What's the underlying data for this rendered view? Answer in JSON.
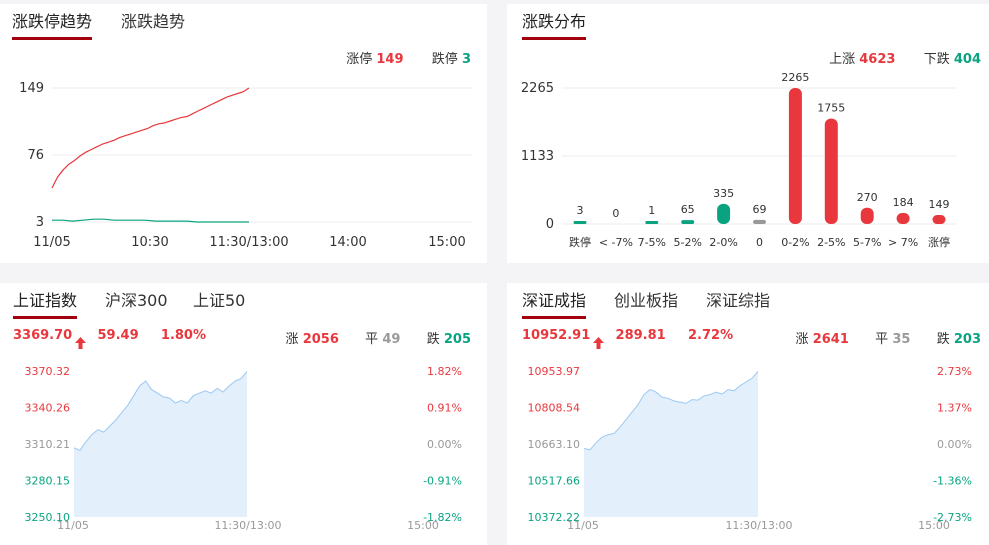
{
  "trend": {
    "tabs": [
      "涨跌停趋势",
      "涨跌趋势"
    ],
    "limit_up_label": "涨停",
    "limit_up_value": "149",
    "limit_down_label": "跌停",
    "limit_down_value": "3",
    "colors": {
      "up": "#e8383d",
      "down": "#0aa381"
    }
  },
  "distribution": {
    "tabs": [
      "涨跌分布"
    ],
    "up_label": "上涨",
    "up_value": "4623",
    "down_label": "下跌",
    "down_value": "404"
  },
  "index_sh": {
    "tabs": [
      "上证指数",
      "沪深300",
      "上证50"
    ],
    "price": "3369.70",
    "change": "59.49",
    "change_pct": "1.80%",
    "up_label": "涨",
    "up_value": "2056",
    "flat_label": "平",
    "flat_value": "49",
    "down_label": "跌",
    "down_value": "205"
  },
  "index_sz": {
    "tabs": [
      "深证成指",
      "创业板指",
      "深证综指"
    ],
    "price": "10952.91",
    "change": "289.81",
    "change_pct": "2.72%",
    "up_label": "涨",
    "up_value": "2641",
    "flat_label": "平",
    "flat_value": "35",
    "down_label": "跌",
    "down_value": "203"
  },
  "chart_data": [
    {
      "type": "line",
      "x_ticks": [
        "11/05",
        "10:30",
        "11:30/13:00",
        "14:00",
        "15:00"
      ],
      "y_ticks": [
        149,
        76,
        3
      ],
      "ylim": [
        3,
        149
      ],
      "series": [
        {
          "name": "涨停",
          "color": "#e8383d",
          "values": [
            40,
            52,
            60,
            66,
            70,
            75,
            79,
            82,
            85,
            88,
            90,
            92,
            95,
            97,
            99,
            101,
            103,
            105,
            108,
            110,
            111,
            113,
            115,
            117,
            118,
            121,
            124,
            127,
            130,
            133,
            136,
            139,
            141,
            143,
            145,
            149
          ]
        },
        {
          "name": "跌停",
          "color": "#0aa381",
          "values": [
            5,
            5,
            4,
            5,
            6,
            6,
            5,
            5,
            5,
            5,
            4,
            4,
            4,
            4,
            3,
            3,
            3,
            3,
            3,
            3
          ]
        }
      ]
    },
    {
      "type": "bar",
      "categories": [
        "跌停",
        "< -7%",
        "7-5%",
        "5-2%",
        "2-0%",
        "0",
        "0-2%",
        "2-5%",
        "5-7%",
        "> 7%",
        "涨停"
      ],
      "values": [
        3,
        0,
        1,
        65,
        335,
        69,
        2265,
        1755,
        270,
        184,
        149
      ],
      "colors": [
        "#0aa381",
        "#0aa381",
        "#0aa381",
        "#0aa381",
        "#0aa381",
        "#999999",
        "#e8383d",
        "#e8383d",
        "#e8383d",
        "#e8383d",
        "#e8383d"
      ],
      "y_ticks": [
        2265,
        1133,
        0
      ],
      "ylim": [
        0,
        2265
      ]
    },
    {
      "type": "area",
      "left_ticks": [
        "3370.32",
        "3340.26",
        "3310.21",
        "3280.15",
        "3250.10"
      ],
      "right_ticks": [
        "1.82%",
        "0.91%",
        "0.00%",
        "-0.91%",
        "-1.82%"
      ],
      "x_ticks": [
        "11/05",
        "11:30/13:00",
        "15:00"
      ],
      "ylim": [
        3250.1,
        3370.32
      ],
      "values": [
        3307,
        3305,
        3312,
        3318,
        3322,
        3320,
        3325,
        3330,
        3336,
        3342,
        3350,
        3358,
        3362,
        3355,
        3352,
        3349,
        3348,
        3344,
        3346,
        3344,
        3350,
        3352,
        3354,
        3352,
        3356,
        3353,
        3358,
        3362,
        3364,
        3370
      ],
      "color": "#9cc8f2"
    },
    {
      "type": "area",
      "left_ticks": [
        "10953.97",
        "10808.54",
        "10663.10",
        "10517.66",
        "10372.22"
      ],
      "right_ticks": [
        "2.73%",
        "1.37%",
        "0.00%",
        "-1.36%",
        "-2.73%"
      ],
      "x_ticks": [
        "11/05",
        "11:30/13:00",
        "15:00"
      ],
      "ylim": [
        10372.22,
        10953.97
      ],
      "values": [
        10645,
        10640,
        10668,
        10690,
        10700,
        10705,
        10730,
        10760,
        10790,
        10820,
        10860,
        10880,
        10870,
        10850,
        10845,
        10835,
        10830,
        10825,
        10840,
        10838,
        10855,
        10860,
        10870,
        10862,
        10880,
        10875,
        10895,
        10910,
        10925,
        10952
      ],
      "color": "#9cc8f2"
    }
  ]
}
